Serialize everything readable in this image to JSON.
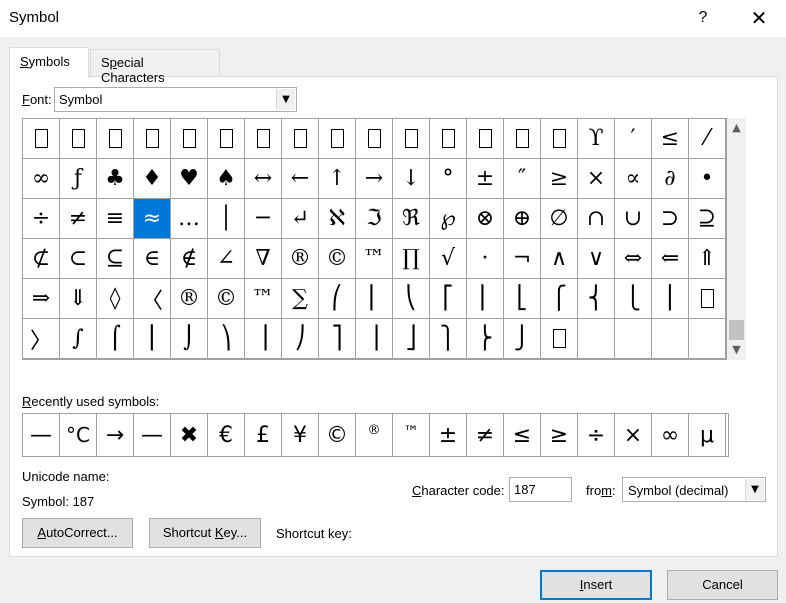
{
  "window": {
    "title": "Symbol",
    "help_label": "?",
    "close_label": "✕"
  },
  "tabs": [
    {
      "label_hot": "S",
      "label_rest": "ymbols",
      "active": true
    },
    {
      "label_hot": "S",
      "label_pre": "",
      "label_rest": "pecial Characters",
      "active": false
    }
  ],
  "font": {
    "label_hot": "F",
    "label_rest": "ont:",
    "value": "Symbol",
    "dropdown_icon": "chevron-down-icon"
  },
  "grid": {
    "rows": [
      [
        "□",
        "□",
        "□",
        "□",
        "□",
        "□",
        "□",
        "□",
        "□",
        "□",
        "□",
        "□",
        "□",
        "□",
        "□",
        "ϒ",
        "′",
        "≤",
        "⁄"
      ],
      [
        "∞",
        "ƒ",
        "♣",
        "♦",
        "♥",
        "♠",
        "↔",
        "←",
        "↑",
        "→",
        "↓",
        "°",
        "±",
        "″",
        "≥",
        "×",
        "∝",
        "∂",
        "•"
      ],
      [
        "÷",
        "≠",
        "≡",
        "≈",
        "…",
        "│",
        "─",
        "↵",
        "ℵ",
        "ℑ",
        "ℜ",
        "℘",
        "⊗",
        "⊕",
        "∅",
        "∩",
        "∪",
        "⊃",
        "⊇"
      ],
      [
        "⊄",
        "⊂",
        "⊆",
        "∈",
        "∉",
        "∠",
        "∇",
        "®",
        "©",
        "™",
        "∏",
        "√",
        "·",
        "¬",
        "∧",
        "∨",
        "⇔",
        "⇐",
        "⇑"
      ],
      [
        "⇒",
        "⇓",
        "◊",
        "〈",
        "®",
        "©",
        "™",
        "∑",
        "⎛",
        "⎜",
        "⎝",
        "⎡",
        "⎢",
        "⎣",
        "⎧",
        "⎨",
        "⎩",
        "⎪",
        "□"
      ],
      [
        "〉",
        "∫",
        "⌠",
        "⎮",
        "⌡",
        "⎞",
        "⎟",
        "⎠",
        "⎤",
        "⎥",
        "⎦",
        "⎫",
        "⎬",
        "⎭",
        "□",
        "",
        "",
        "",
        ""
      ]
    ],
    "selected": {
      "row": 2,
      "col": 3
    },
    "scroll_up_icon": "▲",
    "scroll_down_icon": "▼"
  },
  "recent": {
    "label_hot": "R",
    "label_rest": "ecently used symbols:",
    "symbols": [
      "—",
      "°C",
      "→",
      "—",
      "✖",
      "€",
      "£",
      "¥",
      "©",
      "®",
      "™",
      "±",
      "≠",
      "≤",
      "≥",
      "÷",
      "×",
      "∞",
      "μ"
    ]
  },
  "info": {
    "unicode_name_label": "Unicode name:",
    "symbol_text": "Symbol: 187",
    "char_code_label_hot": "C",
    "char_code_label_pre": "",
    "char_code_label_rest": "haracter code:",
    "char_code_value": "187",
    "from_label_pre": "fro",
    "from_label_hot": "m",
    "from_label_rest": ":",
    "from_value": "Symbol (decimal)"
  },
  "buttons": {
    "autocorrect_hot": "A",
    "autocorrect_rest": "utoCorrect...",
    "shortcut_pre": "Shortcut ",
    "shortcut_hot": "K",
    "shortcut_rest": "ey...",
    "shortcut_key_label": "Shortcut key:",
    "insert_hot": "I",
    "insert_rest": "nsert",
    "cancel_label": "Cancel"
  },
  "colors": {
    "selection": "#0078d7",
    "dialog_bg": "#f0f0f0",
    "panel_bg": "#ffffff"
  }
}
